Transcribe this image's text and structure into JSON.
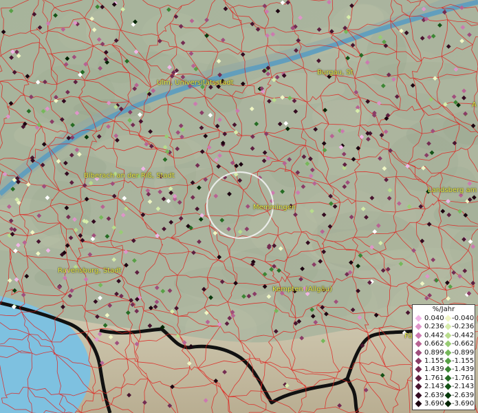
{
  "cities": [
    {
      "name": "Ulm, Universitätsstadt"
    },
    {
      "name": "Burgau, St"
    },
    {
      "name": "Biberach an der Riß, Stadt"
    },
    {
      "name": "Memmingen"
    },
    {
      "name": "Landsberg am"
    },
    {
      "name": "Ravensburg, Stadt"
    },
    {
      "name": "Kempten (Allgäu)"
    },
    {
      "name": "A"
    },
    {
      "name": "Fü"
    }
  ],
  "legend": {
    "title": "%/Jahr",
    "positive": [
      {
        "label": "0.040",
        "color": "#f0b6e6"
      },
      {
        "label": "0.236",
        "color": "#df94c9"
      },
      {
        "label": "0.442",
        "color": "#cc7ab0"
      },
      {
        "label": "0.662",
        "color": "#b86393"
      },
      {
        "label": "0.899",
        "color": "#a04e7c"
      },
      {
        "label": "1.155",
        "color": "#8a3c66"
      },
      {
        "label": "1.439",
        "color": "#742c52"
      },
      {
        "label": "1.761",
        "color": "#5e1f40"
      },
      {
        "label": "2.143",
        "color": "#48142f"
      },
      {
        "label": "2.639",
        "color": "#330b20"
      },
      {
        "label": "3.690",
        "color": "#1c0410"
      }
    ],
    "negative": [
      {
        "label": "-0.040",
        "color": "#f0f6c4"
      },
      {
        "label": "-0.236",
        "color": "#d6ecaa"
      },
      {
        "label": "-0.442",
        "color": "#b8dc8c"
      },
      {
        "label": "-0.662",
        "color": "#98cc74"
      },
      {
        "label": "-0.899",
        "color": "#76b85a"
      },
      {
        "label": "-1.155",
        "color": "#58a046"
      },
      {
        "label": "-1.439",
        "color": "#3c8634"
      },
      {
        "label": "-1.761",
        "color": "#266c24"
      },
      {
        "label": "-2.143",
        "color": "#145216"
      },
      {
        "label": "-2.639",
        "color": "#083a0c"
      },
      {
        "label": "-3.690",
        "color": "#022404"
      }
    ]
  },
  "colors": {
    "boundary": "#e0201c",
    "lake": "#5aa8d0",
    "border": "#111111",
    "mountain": "#c8bfa6",
    "neutral_marker": "#ffffff"
  }
}
